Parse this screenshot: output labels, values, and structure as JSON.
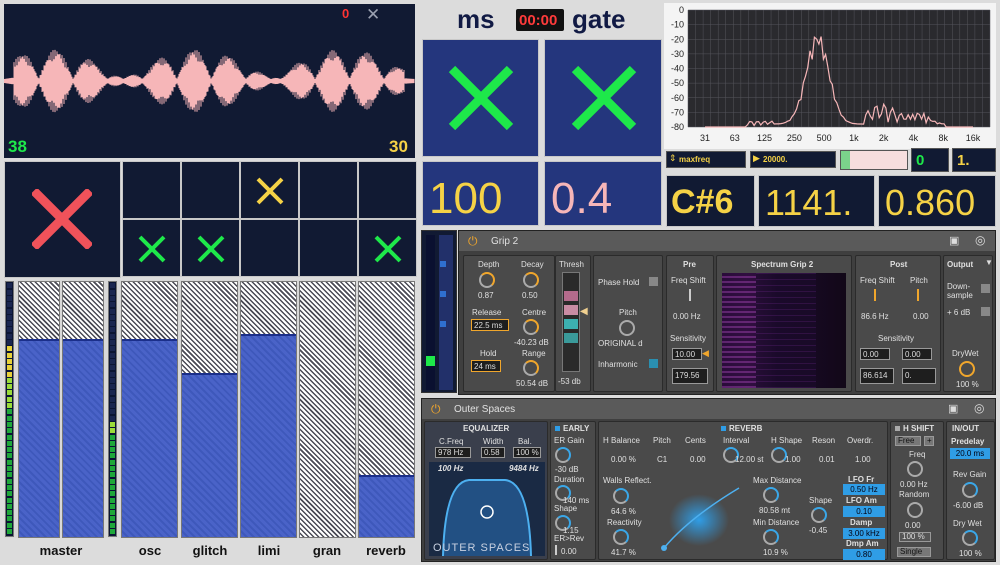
{
  "waveform": {
    "left_number": "38",
    "right_number": "30",
    "count_red": "0",
    "close_glyph": "✕"
  },
  "channels": [
    "master",
    "osc",
    "glitch",
    "limi",
    "gran",
    "reverb"
  ],
  "header": {
    "ms": "ms",
    "time": "00:00",
    "gate": "gate"
  },
  "values": {
    "v1": "100",
    "v2": "0.4"
  },
  "spectrum": {
    "yticks": [
      "0",
      "-10",
      "-20",
      "-30",
      "-40",
      "-50",
      "-60",
      "-70",
      "-80"
    ],
    "xticks": [
      "31",
      "63",
      "125",
      "250",
      "500",
      "1k",
      "2k",
      "4k",
      "8k",
      "16k"
    ],
    "param_name": "maxfreq",
    "param_value": "20000.",
    "num1": "0",
    "num2": "1."
  },
  "readouts": {
    "note": "C#6",
    "freq": "1141.",
    "ratio": "0.860"
  },
  "grip": {
    "title": "Grip 2",
    "depth_label": "Depth",
    "depth_val": "0.87",
    "decay_label": "Decay",
    "decay_val": "0.50",
    "release_label": "Release",
    "release_val": "22.5 ms",
    "centre_label": "Centre",
    "centre_val": "-40.23 dB",
    "hold_label": "Hold",
    "hold_val": "24 ms",
    "range_label": "Range",
    "range_val": "50.54 dB",
    "thresh_label": "Thresh",
    "thresh_val": "-53 db",
    "phase_label": "Phase Hold",
    "pitch_label": "Pitch",
    "pitch_val": "ORIGINAL d",
    "inharm_label": "Inharmonic",
    "pre_title": "Pre",
    "freqshift_label": "Freq Shift",
    "freqshift_val": "0.00 Hz",
    "sens_label": "Sensitivity",
    "sens_val": "10.00",
    "sens_val2": "179.56",
    "spec_title": "Spectrum Grip 2",
    "post_title": "Post",
    "post_fs_label": "Freq Shift",
    "post_fs_val": "86.6 Hz",
    "post_pitch_label": "Pitch",
    "post_pitch_val": "0.00",
    "post_sens_label": "Sensitivity",
    "post_sens_a": "0.00",
    "post_sens_b": "0.00",
    "post_out_a": "86.614",
    "post_out_b": "0.",
    "output_title": "Output",
    "down_label": "Down-",
    "sample_label": "sample",
    "sixdb_label": "+ 6 dB",
    "drywet_label": "DryWet",
    "drywet_val": "100 %"
  },
  "outer": {
    "title": "Outer Spaces",
    "eq_title": "EQUALIZER",
    "cfreq_label": "C.Freq",
    "cfreq_val": "978 Hz",
    "width_label": "Width",
    "width_val": "0.58",
    "bal_label": "Bal.",
    "bal_val": "100 %",
    "lo_val": "100 Hz",
    "hi_val": "9484 Hz",
    "logo": "OUTER SPACES",
    "early_title": "EARLY",
    "ergain_label": "ER Gain",
    "ergain_val": "-30 dB",
    "dur_label": "Duration",
    "dur_val": "140 ms",
    "shape_label": "Shape",
    "shape_val": "1.15",
    "errev_label": "ER>Rev",
    "errev_val": "0.00",
    "reverb_title": "REVERB",
    "hbal_label": "H Balance",
    "hbal_val": "0.00 %",
    "pitch_label": "Pitch",
    "pitch_val": "C1",
    "cents_label": "Cents",
    "cents_val": "0.00",
    "interval_label": "Interval",
    "interval_val": "12.00 st",
    "hshape_label": "H Shape",
    "hshape_val": "1.00",
    "reson_label": "Reson",
    "reson_val": "0.01",
    "overdr_label": "Overdr.",
    "overdr_val": "1.00",
    "walls_label": "Walls Reflect.",
    "walls_val": "64.6 %",
    "react_label": "Reactivity",
    "react_val": "41.7 %",
    "maxd_label": "Max Distance",
    "maxd_val": "80.58 mt",
    "mind_label": "Min Distance",
    "mind_val": "10.9 %",
    "shape2_label": "Shape",
    "shape2_val": "-0.45",
    "lofr_label": "LFO Fr",
    "lofr_val": "0.50 Hz",
    "loam_label": "LFO Am",
    "loam_val": "0.10",
    "damp_label": "Damp",
    "damp_val": "3.00 kHz",
    "dmpam_label": "Dmp Am",
    "dmpam_val": "0.80",
    "hshift_title": "H SHIFT",
    "free_label": "Free",
    "plus": "+",
    "freq_label": "Freq",
    "freq_val": "0.00 Hz",
    "random_label": "Random",
    "random_val": "0.00",
    "pct_val": "100 %",
    "single_label": "Single",
    "inout_title": "IN/OUT",
    "predelay_label": "Predelay",
    "predelay_val": "20.0 ms",
    "revgain_label": "Rev Gain",
    "revgain_val": "-6.00 dB",
    "drywet_label": "Dry Wet",
    "drywet_val": "100 %"
  },
  "colors": {
    "navy": "#111a33",
    "green": "#1ee84a",
    "red": "#f0525a",
    "yellow": "#f5d246",
    "pink": "#f6b6b8",
    "blue": "#2f9de6"
  }
}
